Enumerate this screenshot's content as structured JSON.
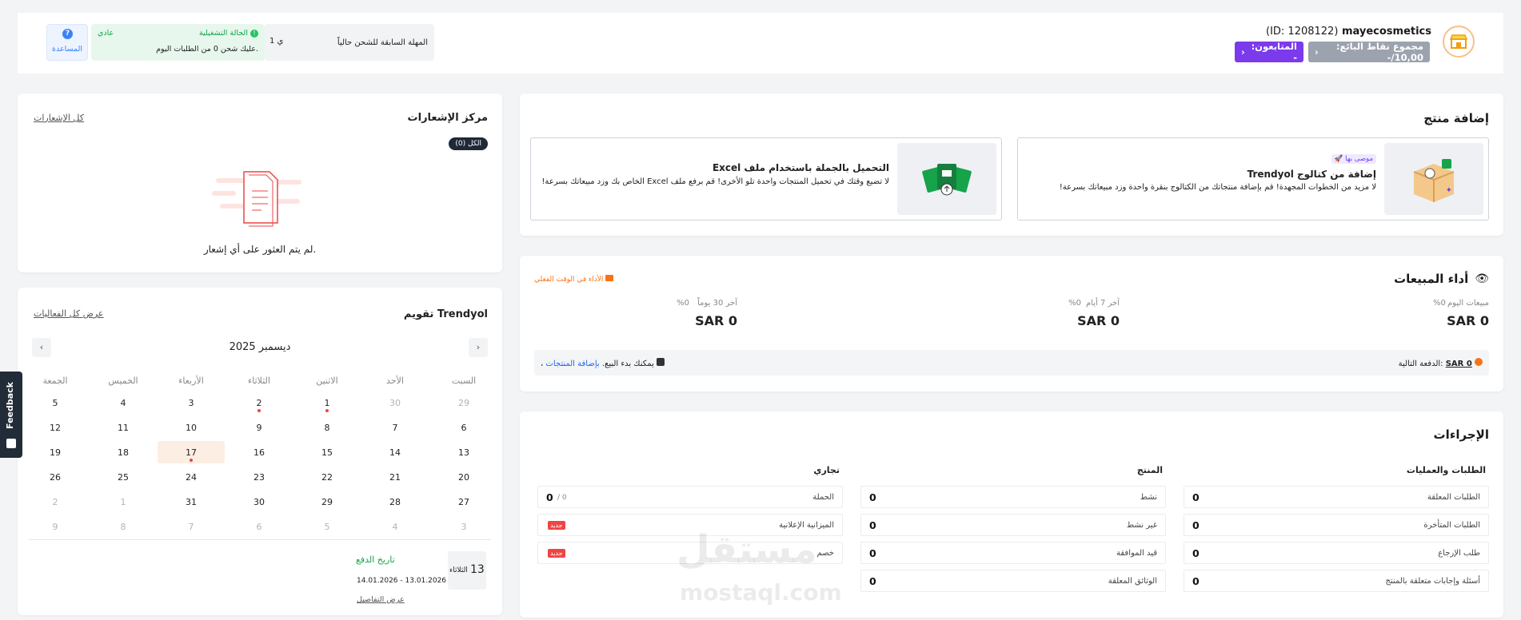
{
  "header": {
    "store_name": "mayecosmetics",
    "store_id": "(ID: 1208122)",
    "seller_points": "مجموع نقاط البائع: 10,00/-",
    "followers": "المتابعون: -",
    "shipping_deadline_label": "المهلة السابقة للشحن حالياً",
    "shipping_deadline_value": "1 ي",
    "status_label": "الحالة التشغيلية",
    "status_value": "عادي",
    "status_desc": "عليك شحن 0 من الطلبات اليوم.",
    "help_label": "المساعدة"
  },
  "add_product": {
    "title": "إضافة منتج",
    "catalog": {
      "badge": "موصى بها",
      "title": "إضافة من كتالوج Trendyol",
      "desc": "لا مزيد من الخطوات المجهدة! قم بإضافة منتجاتك من الكتالوج بنقرة واحدة وزد مبيعاتك بسرعة!"
    },
    "excel": {
      "title": "التحميل بالجملة باستخدام ملف Excel",
      "desc": "لا تضيع وقتك في تحميل المنتجات واحدة تلو الأخرى! قم برفع ملف Excel الخاص بك وزد مبيعاتك بسرعة!"
    }
  },
  "notifications": {
    "title": "مركز الإشعارات",
    "all_link": "كل الإشعارات",
    "filter_all": "الكل (0)",
    "empty_text": "لم يتم العثور على أي إشعار."
  },
  "sales": {
    "title": "أداء المبيعات",
    "realtime": "الأداء في الوقت الفعلي",
    "stats": [
      {
        "label": "مبيعات اليوم",
        "pct": "%0",
        "value": "SAR 0"
      },
      {
        "label": "آخر 7 أيام",
        "pct": "%0",
        "value": "SAR 0"
      },
      {
        "label": "آخر 30 يوماً",
        "pct": "%0",
        "value": "SAR 0"
      }
    ],
    "next_payment_label": "الدفعة التالية:",
    "next_payment_value": "SAR 0",
    "add_products_link": "بإضافة المنتجات",
    "add_products_rest": "، يمكنك بدء البيع."
  },
  "calendar": {
    "title": "تقويم Trendyol",
    "all_events": "عرض كل الفعاليات",
    "month": "ديسمبر 2025",
    "weekdays": [
      "السبت",
      "الأحد",
      "الاثنين",
      "الثلاثاء",
      "الأربعاء",
      "الخميس",
      "الجمعة"
    ],
    "weeks": [
      [
        "29",
        "30",
        "1",
        "2",
        "3",
        "4",
        "5"
      ],
      [
        "6",
        "7",
        "8",
        "9",
        "10",
        "11",
        "12"
      ],
      [
        "13",
        "14",
        "15",
        "16",
        "17",
        "18",
        "19"
      ],
      [
        "20",
        "21",
        "22",
        "23",
        "24",
        "25",
        "26"
      ],
      [
        "27",
        "28",
        "29",
        "30",
        "31",
        "1",
        "2"
      ],
      [
        "3",
        "4",
        "5",
        "6",
        "7",
        "8",
        "9"
      ]
    ],
    "event_day_num": "13",
    "event_day_name": "الثلاثاء",
    "event_title": "تاريخ الدفع",
    "event_range": "14.01.2026 - 13.01.2026",
    "event_details": "عرض التفاصيل"
  },
  "actions": {
    "title": "الإجراءات",
    "groups": [
      {
        "title": "الطلبات والعمليات",
        "rows": [
          {
            "label": "الطلبات المعلقة",
            "value": "0"
          },
          {
            "label": "الطلبات المتأخرة",
            "value": "0"
          },
          {
            "label": "طلب الإرجاع",
            "value": "0"
          },
          {
            "label": "أسئلة وإجابات متعلقة بالمنتج",
            "value": "0"
          }
        ]
      },
      {
        "title": "المنتج",
        "rows": [
          {
            "label": "نشط",
            "value": "0"
          },
          {
            "label": "غير نشط",
            "value": "0"
          },
          {
            "label": "قيد الموافقة",
            "value": "0"
          },
          {
            "label": "الوثائق المعلقة",
            "value": "0"
          }
        ]
      },
      {
        "title": "تجاري",
        "rows": [
          {
            "label": "الحملة",
            "value": "0",
            "extra": "/ 0"
          },
          {
            "label": "الميزانية الإعلانية",
            "badge": "جديد"
          },
          {
            "label": "خصم",
            "badge": "جديد"
          }
        ]
      }
    ]
  },
  "feedback": "Feedback",
  "watermark": {
    "arabic": "مستقل",
    "latin": "mostaql.com"
  },
  "colors": {
    "purple": "#7c3aed",
    "accent": "#f97316",
    "green": "#22c55e",
    "red": "#ef4444",
    "blue": "#2563eb"
  }
}
